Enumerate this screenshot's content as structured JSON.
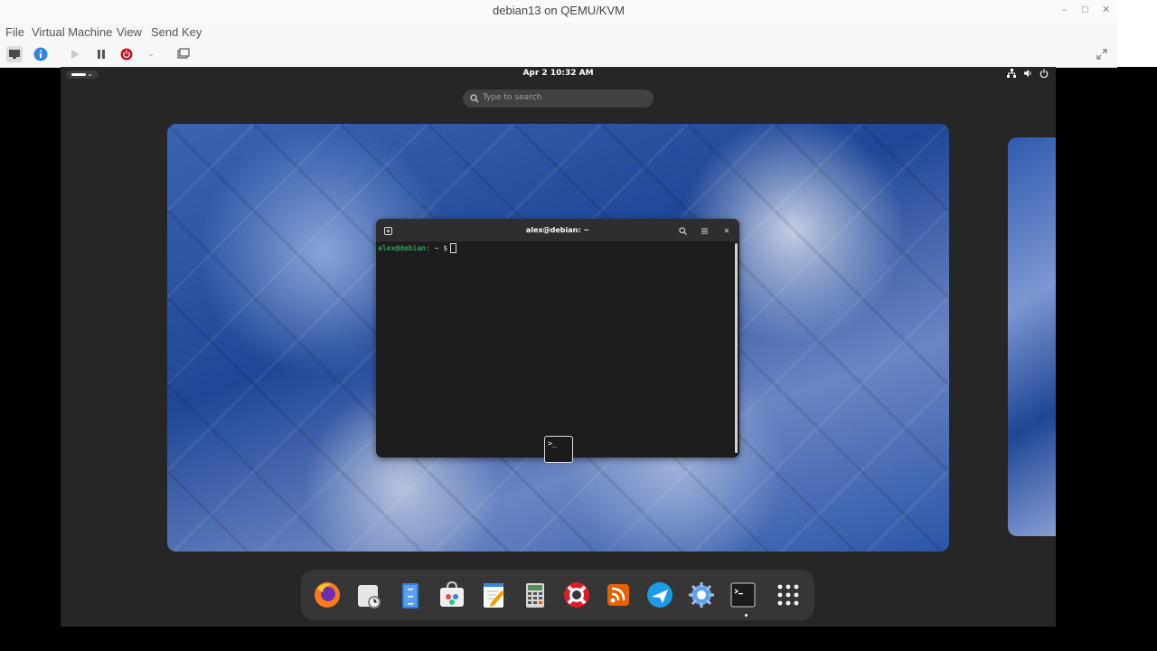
{
  "host": {
    "title": "debian13 on QEMU/KVM",
    "menu": [
      "File",
      "Virtual Machine",
      "View",
      "Send Key"
    ]
  },
  "guest": {
    "clock": "Apr 2  10:32 AM",
    "search_placeholder": "Type to search",
    "terminal": {
      "title": "alex@debian: ~",
      "prompt_user": "alex@debian:",
      "prompt_tail": " ~ $"
    },
    "dock_apps": [
      "firefox-icon",
      "clocks-icon",
      "files-icon",
      "software-icon",
      "text-editor-icon",
      "calculator-icon",
      "help-icon",
      "rss-icon",
      "maps-icon",
      "settings-icon",
      "terminal-icon",
      "app-grid-icon"
    ]
  },
  "colors": {
    "accent": "#3584e4",
    "prompt_green": "#33d17a",
    "power_red": "#c0142c"
  }
}
